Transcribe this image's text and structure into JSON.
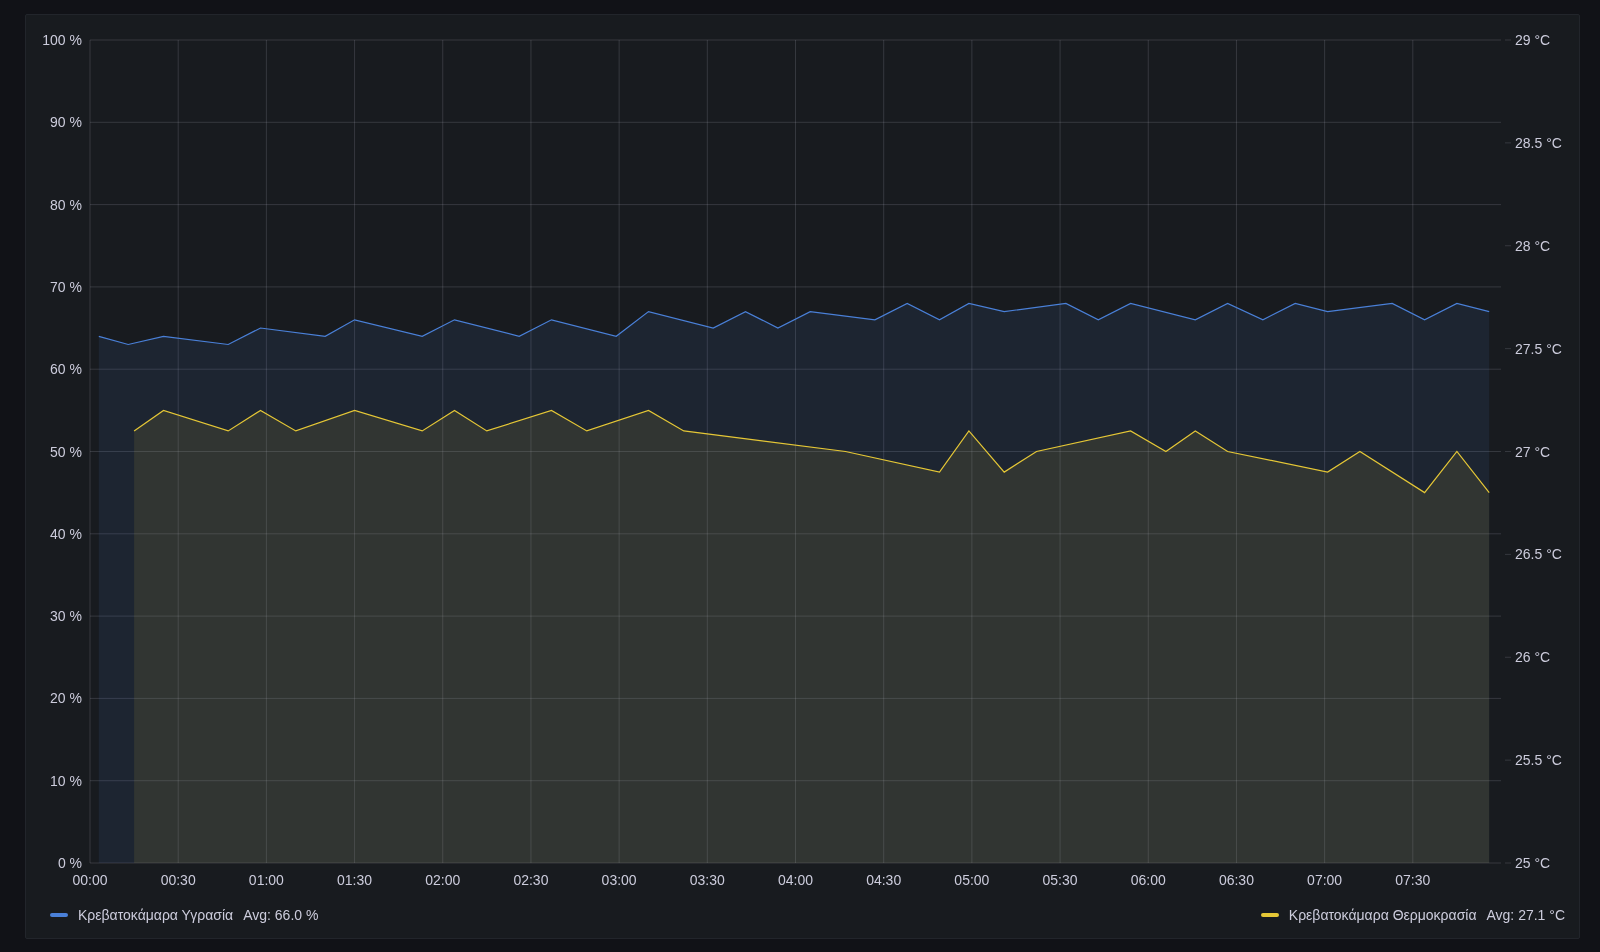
{
  "panel": {
    "chart_data": {
      "type": "area",
      "grid": true,
      "xlim": [
        0,
        480
      ],
      "ylim": [
        0,
        100
      ],
      "y2lim": [
        25,
        29
      ],
      "xticks": [
        {
          "value": 0,
          "label": "00:00"
        },
        {
          "value": 30,
          "label": "00:30"
        },
        {
          "value": 60,
          "label": "01:00"
        },
        {
          "value": 90,
          "label": "01:30"
        },
        {
          "value": 120,
          "label": "02:00"
        },
        {
          "value": 150,
          "label": "02:30"
        },
        {
          "value": 180,
          "label": "03:00"
        },
        {
          "value": 210,
          "label": "03:30"
        },
        {
          "value": 240,
          "label": "04:00"
        },
        {
          "value": 270,
          "label": "04:30"
        },
        {
          "value": 300,
          "label": "05:00"
        },
        {
          "value": 330,
          "label": "05:30"
        },
        {
          "value": 360,
          "label": "06:00"
        },
        {
          "value": 390,
          "label": "06:30"
        },
        {
          "value": 420,
          "label": "07:00"
        },
        {
          "value": 450,
          "label": "07:30"
        }
      ],
      "yticks": [
        {
          "value": 0,
          "label": "0 %"
        },
        {
          "value": 10,
          "label": "10 %"
        },
        {
          "value": 20,
          "label": "20 %"
        },
        {
          "value": 30,
          "label": "30 %"
        },
        {
          "value": 40,
          "label": "40 %"
        },
        {
          "value": 50,
          "label": "50 %"
        },
        {
          "value": 60,
          "label": "60 %"
        },
        {
          "value": 70,
          "label": "70 %"
        },
        {
          "value": 80,
          "label": "80 %"
        },
        {
          "value": 90,
          "label": "90 %"
        },
        {
          "value": 100,
          "label": "100 %"
        }
      ],
      "y2ticks": [
        {
          "value": 25,
          "label": "25 °C"
        },
        {
          "value": 25.5,
          "label": "25.5 °C"
        },
        {
          "value": 26,
          "label": "26 °C"
        },
        {
          "value": 26.5,
          "label": "26.5 °C"
        },
        {
          "value": 27,
          "label": "27 °C"
        },
        {
          "value": 27.5,
          "label": "27.5 °C"
        },
        {
          "value": 28,
          "label": "28 °C"
        },
        {
          "value": 28.5,
          "label": "28.5 °C"
        },
        {
          "value": 29,
          "label": "29 °C"
        }
      ],
      "x": [
        3,
        13,
        15,
        25,
        47,
        58,
        70,
        80,
        90,
        113,
        124,
        135,
        146,
        157,
        169,
        179,
        190,
        202,
        212,
        223,
        234,
        245,
        257,
        267,
        278,
        289,
        299,
        311,
        322,
        332,
        343,
        354,
        366,
        376,
        387,
        399,
        410,
        421,
        432,
        443,
        454,
        465,
        476
      ],
      "series": [
        {
          "name": "Κρεβατοκάμαρα Υγρασία",
          "color": "#4a80d8",
          "values": [
            64,
            63,
            null,
            64,
            63,
            65,
            null,
            64,
            66,
            64,
            66,
            null,
            64,
            66,
            null,
            64,
            67,
            null,
            65,
            67,
            65,
            67,
            null,
            66,
            68,
            66,
            68,
            67,
            null,
            68,
            66,
            68,
            null,
            66,
            68,
            66,
            68,
            67,
            null,
            68,
            66,
            68,
            67
          ]
        },
        {
          "name": "Κρεβατοκάμαρα Θερμοκρασία",
          "color": "#e5c736",
          "axis": "y2",
          "values": [
            null,
            null,
            27.1,
            27.2,
            27.1,
            27.2,
            27.1,
            null,
            27.2,
            27.1,
            27.2,
            27.1,
            null,
            27.2,
            27.1,
            null,
            27.2,
            27.1,
            null,
            null,
            null,
            null,
            27.0,
            null,
            null,
            26.9,
            27.1,
            26.9,
            27.0,
            null,
            null,
            27.1,
            27.0,
            27.1,
            27.0,
            null,
            null,
            26.9,
            27.0,
            null,
            26.8,
            27.0,
            26.8
          ]
        }
      ]
    },
    "legend": [
      {
        "stat": "Avg: 66.0 %"
      },
      {
        "stat": "Avg: 27.1 °C"
      }
    ]
  }
}
